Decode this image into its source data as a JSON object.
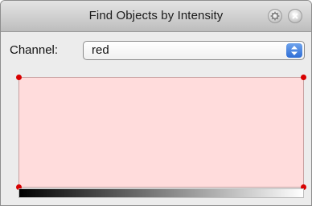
{
  "window": {
    "title": "Find Objects by Intensity",
    "buttons": [
      {
        "name": "gear",
        "icon": "gear-icon"
      },
      {
        "name": "close",
        "icon": "close-icon"
      }
    ]
  },
  "channel": {
    "label": "Channel:",
    "selected": "red"
  },
  "histogram": {
    "fill_color": "#ffdcdc",
    "handle_color": "#d80000",
    "gradient": [
      "#000000",
      "#ffffff"
    ]
  }
}
